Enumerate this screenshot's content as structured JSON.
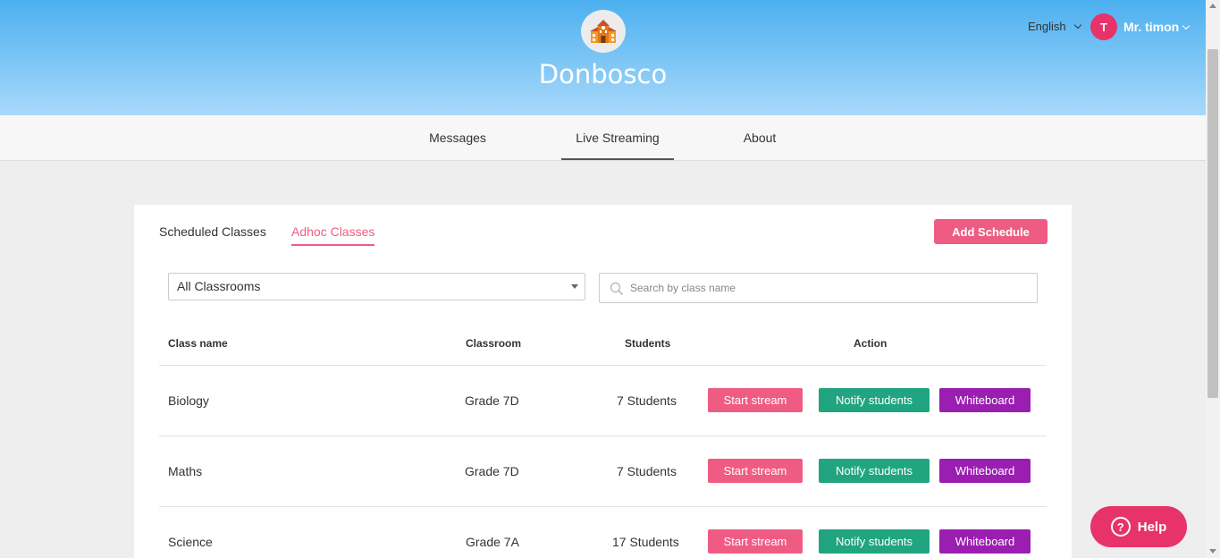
{
  "header": {
    "school_name": "Donbosco",
    "language": "English",
    "user_initial": "T",
    "user_name": "Mr. timon"
  },
  "nav": {
    "items": [
      {
        "label": "Messages"
      },
      {
        "label": "Live Streaming",
        "active": true
      },
      {
        "label": "About"
      }
    ]
  },
  "tabs": [
    {
      "label": "Scheduled Classes"
    },
    {
      "label": "Adhoc Classes",
      "active": true
    }
  ],
  "add_schedule_label": "Add Schedule",
  "filter": {
    "classroom_selected": "All Classrooms",
    "search_placeholder": "Search by class name"
  },
  "table": {
    "headers": [
      "Class name",
      "Classroom",
      "Students",
      "Action"
    ],
    "rows": [
      {
        "class_name": "Biology",
        "classroom": "Grade 7D",
        "students": "7 Students"
      },
      {
        "class_name": "Maths",
        "classroom": "Grade 7D",
        "students": "7 Students"
      },
      {
        "class_name": "Science",
        "classroom": "Grade 7A",
        "students": "17 Students"
      }
    ],
    "actions": {
      "start": "Start stream",
      "notify": "Notify students",
      "whiteboard": "Whiteboard"
    }
  },
  "help_label": "Help",
  "colors": {
    "accent": "#ef5c83",
    "notify": "#21a580",
    "whiteboard": "#9a1fb1",
    "header_gradient_top": "#4cb0f0",
    "header_gradient_bottom": "#a9d9fa"
  }
}
